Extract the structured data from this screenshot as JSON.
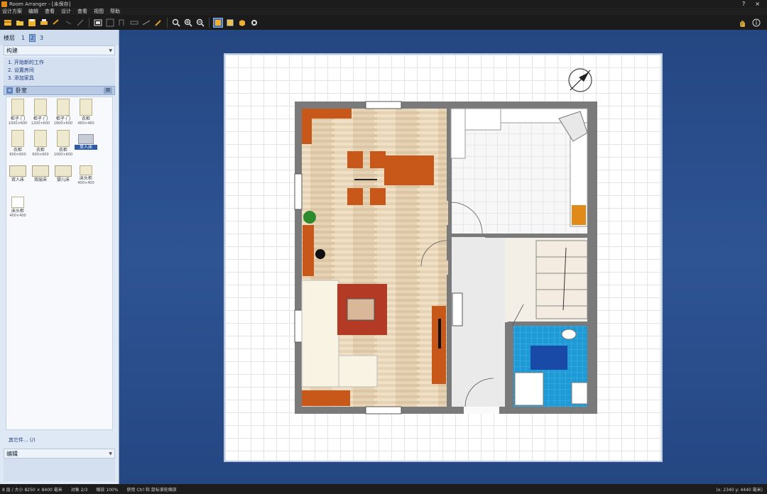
{
  "window": {
    "title": "Room Arranger - [未保存]",
    "help": "?",
    "close": "×"
  },
  "menu": [
    "设计方案",
    "编辑",
    "查看",
    "设计",
    "查看",
    "视图",
    "帮助"
  ],
  "toolbar": {
    "buttons": [
      "new-icon",
      "open-icon",
      "save-icon",
      "print-icon",
      "undo-icon",
      "redo-icon",
      "line-icon",
      "rect-icon",
      "wall-icon",
      "door-icon",
      "window-icon",
      "measure-icon",
      "pencil-icon",
      "zoom-fit-icon",
      "zoom-in-icon",
      "zoom-out-icon",
      "3d-view-icon",
      "floor-view-icon",
      "object-view-icon",
      "settings-icon"
    ],
    "right_buttons": [
      "hand-icon",
      "info-icon"
    ]
  },
  "left": {
    "floors_label": "楼层",
    "floors": [
      "1",
      "2",
      "3"
    ],
    "selected_floor": "2",
    "section": "构建",
    "steps": [
      "1. 开始新的工作",
      "2. 设置房间",
      "3. 添加家具"
    ],
    "category": "卧室",
    "items": [
      {
        "name": "柜子 门",
        "size": "1000×600"
      },
      {
        "name": "柜子 门",
        "size": "1200×600"
      },
      {
        "name": "柜子 门",
        "size": "1800×600"
      },
      {
        "name": "衣柜",
        "size": "460×460"
      },
      {
        "name": "衣柜",
        "size": "600×600"
      },
      {
        "name": "衣柜",
        "size": "600×600"
      },
      {
        "name": "衣柜",
        "size": "1000×600"
      },
      {
        "name": "单人床",
        "size": ""
      },
      {
        "name": "双人床",
        "size": ""
      },
      {
        "name": "双层床",
        "size": ""
      },
      {
        "name": "婴儿床",
        "size": ""
      },
      {
        "name": "床头柜",
        "size": "400×400"
      },
      {
        "name": "床头柜",
        "size": "400×400"
      }
    ],
    "more": "其它件... (/)",
    "edit_section": "编辑"
  },
  "status": {
    "size": "8 层 / 大小 8250 × 8400 毫米",
    "object": "对象 2/3",
    "zoom": "缩放 100%",
    "hint": "使用 Ctrl 和 鼠标滚轮缩放",
    "coords": "(x: 2340 y: 4440 毫米)"
  },
  "colors": {
    "wall": "#7a7a7a",
    "wood": "#e3cfb0",
    "accent": "#c8571a",
    "tile_blue": "#1e9ad6",
    "bath_blue": "#1a4aa8"
  }
}
